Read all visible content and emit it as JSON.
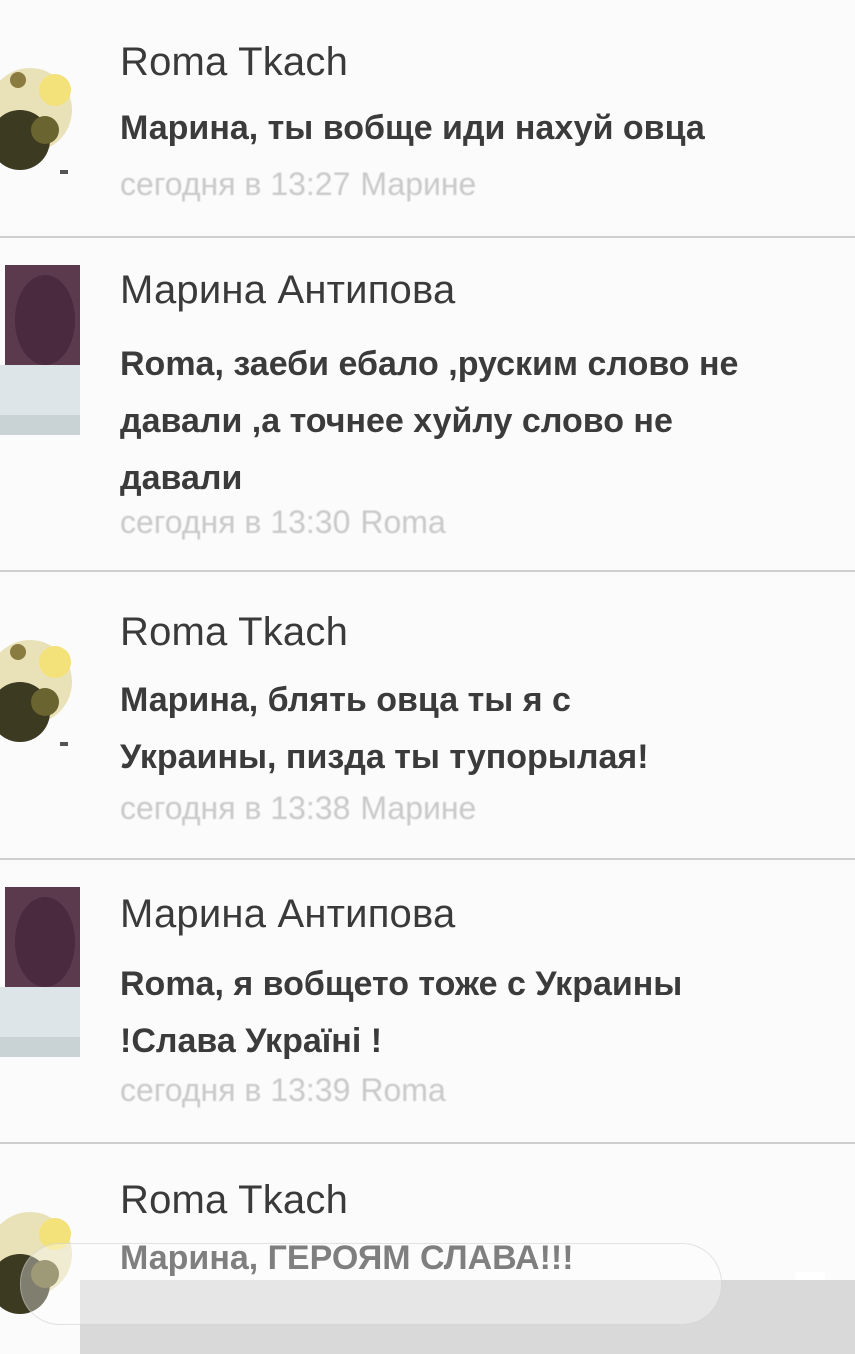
{
  "comments": [
    {
      "author": "Roma Tkach",
      "text": "Марина, ты вобще иди нахуй овца",
      "time": "сегодня в 13:27",
      "reply_to": "Марине",
      "avatar_icon": "avatar-roma-icon"
    },
    {
      "author": "Марина Антипова",
      "text": "Roma, заеби ебало ,руским слово не\nдавали ,а точнее хуйлу слово не\nдавали",
      "time": "сегодня в 13:30",
      "reply_to": "Roma",
      "avatar_icon": "avatar-marina-icon"
    },
    {
      "author": "Roma Tkach",
      "text": "Марина, блять овца ты я с\nУкраины, пизда ты тупорылая!",
      "time": "сегодня в 13:38",
      "reply_to": "Марине",
      "avatar_icon": "avatar-roma-icon"
    },
    {
      "author": "Марина Антипова",
      "text": "Roma, я вобщето тоже с Украины\n!Слава Україні !",
      "time": "сегодня в 13:39",
      "reply_to": "Roma",
      "avatar_icon": "avatar-marina-icon"
    },
    {
      "author": "Roma Tkach",
      "text": "Марина, ГЕРОЯМ СЛАВА!!!",
      "time": "",
      "reply_to": "",
      "avatar_icon": "avatar-roma-icon"
    }
  ]
}
